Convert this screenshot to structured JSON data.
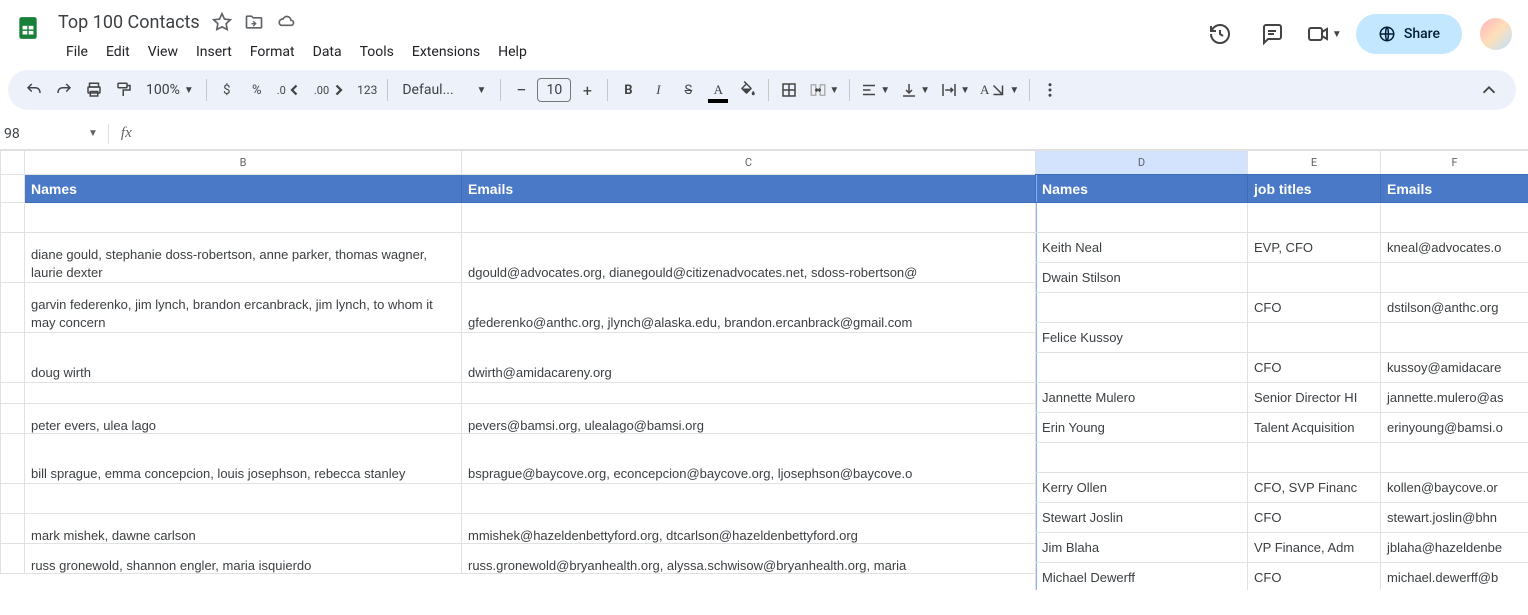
{
  "doc": {
    "title": "Top 100 Contacts"
  },
  "menus": [
    "File",
    "Edit",
    "View",
    "Insert",
    "Format",
    "Data",
    "Tools",
    "Extensions",
    "Help"
  ],
  "namebox": "98",
  "share": "Share",
  "toolbar": {
    "zoom": "100%",
    "currency": "$",
    "percent": "%",
    "dec_dec": ".0",
    "inc_dec": ".00",
    "num123": "123",
    "font": "Defaul...",
    "minus": "−",
    "size": "10",
    "plus": "+",
    "bold": "B",
    "italic": "I",
    "strike": "S",
    "textA": "A"
  },
  "cols": {
    "B": "B",
    "C": "C",
    "D": "D",
    "E": "E",
    "F": "F"
  },
  "headers": {
    "B": "Names",
    "C": "Emails",
    "D": "Names",
    "E": "job titles",
    "F": "Emails"
  },
  "left_rows": [
    {
      "b": "",
      "c": ""
    },
    {
      "b": "diane gould, stephanie doss-robertson, anne parker, thomas wagner, laurie dexter",
      "c": "dgould@advocates.org, dianegould@citizenadvocates.net, sdoss-robertson@"
    },
    {
      "b": "garvin federenko, jim lynch, brandon ercanbrack, jim lynch, to whom it may concern",
      "c": "gfederenko@anthc.org, jlynch@alaska.edu, brandon.ercanbrack@gmail.com"
    },
    {
      "b": "doug wirth",
      "c": "dwirth@amidacareny.org"
    },
    {
      "b": "",
      "c": ""
    },
    {
      "b": "peter evers, ulea lago",
      "c": "pevers@bamsi.org, ulealago@bamsi.org"
    },
    {
      "b": "bill sprague, emma concepcion, louis josephson, rebecca stanley",
      "c": "bsprague@baycove.org, econcepcion@baycove.org, ljosephson@baycove.o"
    },
    {
      "b": "",
      "c": ""
    },
    {
      "b": "mark mishek, dawne carlson",
      "c": "mmishek@hazeldenbettyford.org, dtcarlson@hazeldenbettyford.org"
    },
    {
      "b": "russ gronewold, shannon engler, maria isquierdo",
      "c": "russ.gronewold@bryanhealth.org, alyssa.schwisow@bryanhealth.org, maria"
    }
  ],
  "right_rows": [
    {
      "d": "",
      "e": "",
      "f": ""
    },
    {
      "d": "Keith Neal",
      "e": "EVP, CFO",
      "f": "kneal@advocates.o"
    },
    {
      "d": "Dwain Stilson",
      "e": "",
      "f": ""
    },
    {
      "d": "",
      "e": "CFO",
      "f": "dstilson@anthc.org"
    },
    {
      "d": "Felice Kussoy",
      "e": "",
      "f": ""
    },
    {
      "d": "",
      "e": "CFO",
      "f": "kussoy@amidacare"
    },
    {
      "d": "Jannette Mulero",
      "e": "Senior Director HI",
      "f": "jannette.mulero@as"
    },
    {
      "d": "Erin Young",
      "e": "Talent Acquisition",
      "f": "erinyoung@bamsi.o"
    },
    {
      "d": "",
      "e": "",
      "f": ""
    },
    {
      "d": "Kerry Ollen",
      "e": "CFO, SVP Financ",
      "f": "kollen@baycove.or"
    },
    {
      "d": "Stewart Joslin",
      "e": "CFO",
      "f": "stewart.joslin@bhn"
    },
    {
      "d": "Jim Blaha",
      "e": "VP Finance, Adm",
      "f": "jblaha@hazeldenbe"
    },
    {
      "d": "Michael Dewerff",
      "e": "CFO",
      "f": "michael.dewerff@b"
    }
  ]
}
